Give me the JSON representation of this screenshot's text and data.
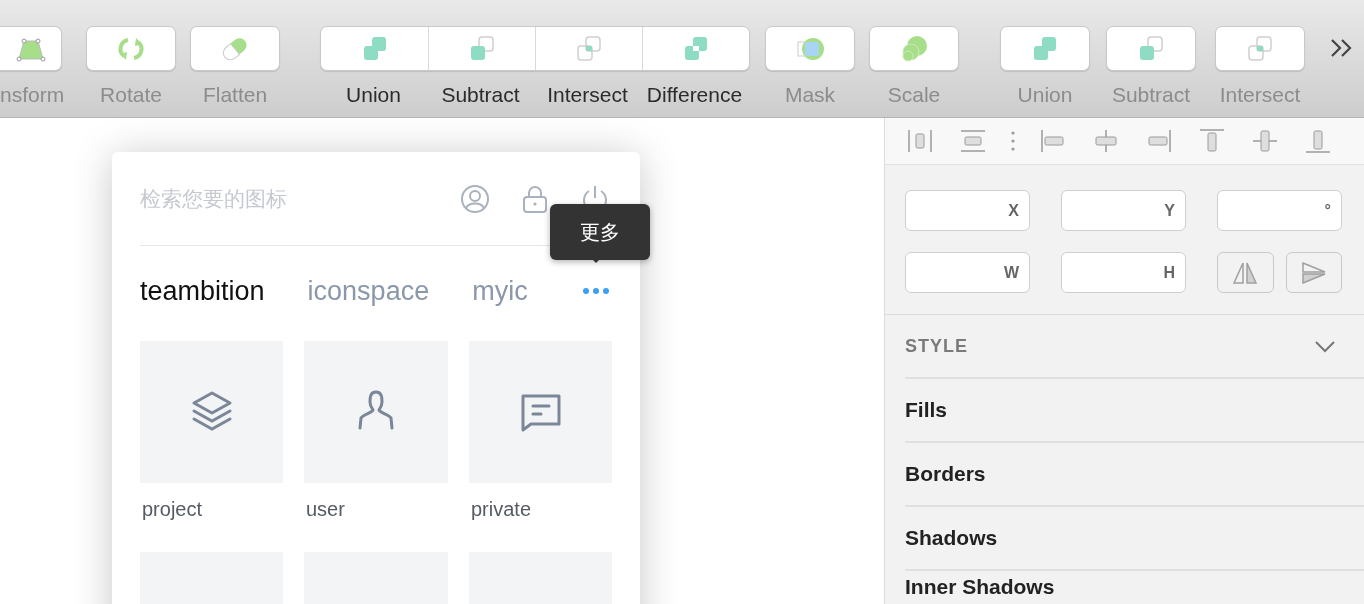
{
  "toolbar": {
    "groups": [
      {
        "tools": [
          {
            "label": "nsform",
            "kind": "transform",
            "disabled": true
          }
        ]
      },
      {
        "tools": [
          {
            "label": "Rotate",
            "kind": "rotate",
            "disabled": true
          }
        ]
      },
      {
        "tools": [
          {
            "label": "Flatten",
            "kind": "flatten",
            "disabled": true
          }
        ]
      },
      {
        "tools": [
          {
            "label": "Union",
            "kind": "union",
            "disabled": false
          },
          {
            "label": "Subtract",
            "kind": "subtract",
            "disabled": false
          },
          {
            "label": "Intersect",
            "kind": "intersect",
            "disabled": false
          },
          {
            "label": "Difference",
            "kind": "difference",
            "disabled": false
          }
        ]
      },
      {
        "tools": [
          {
            "label": "Mask",
            "kind": "mask",
            "disabled": true
          }
        ]
      },
      {
        "tools": [
          {
            "label": "Scale",
            "kind": "scale",
            "disabled": true
          }
        ]
      },
      {
        "tools": [
          {
            "label": "Union",
            "kind": "union",
            "disabled": true
          }
        ]
      },
      {
        "tools": [
          {
            "label": "Subtract",
            "kind": "subtract",
            "disabled": true
          }
        ]
      },
      {
        "tools": [
          {
            "label": "Intersect",
            "kind": "intersect",
            "disabled": true
          }
        ]
      }
    ]
  },
  "icon_panel": {
    "search": {
      "placeholder": "检索您要的图标"
    },
    "tooltip": "更多",
    "tabs": [
      {
        "label": "teambition",
        "selected": true
      },
      {
        "label": "iconspace",
        "selected": false
      },
      {
        "label": "myic",
        "selected": false
      }
    ],
    "icons": [
      {
        "label": "project",
        "kind": "layers"
      },
      {
        "label": "user",
        "kind": "person"
      },
      {
        "label": "private",
        "kind": "message"
      },
      {
        "kind": "partial"
      },
      {
        "kind": "partial"
      },
      {
        "kind": "partial"
      }
    ]
  },
  "inspector": {
    "fields": [
      {
        "label": "X"
      },
      {
        "label": "Y"
      },
      {
        "label": "°"
      },
      {
        "label": "W"
      },
      {
        "label": "H"
      }
    ],
    "style": {
      "title": "STYLE",
      "expanded": true,
      "sections": [
        "Fills",
        "Borders",
        "Shadows",
        "Inner Shadows"
      ]
    }
  }
}
